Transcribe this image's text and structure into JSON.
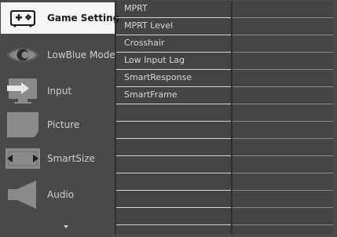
{
  "menu": {
    "items": [
      {
        "label": "Game Setting",
        "icon": "gamepad-icon",
        "active": true
      },
      {
        "label": "LowBlue Mode",
        "icon": "eye-icon",
        "active": false
      },
      {
        "label": "Input",
        "icon": "input-icon",
        "active": false
      },
      {
        "label": "Picture",
        "icon": "picture-icon",
        "active": false
      },
      {
        "label": "SmartSize",
        "icon": "smartsize-icon",
        "active": false
      },
      {
        "label": "Audio",
        "icon": "speaker-icon",
        "active": false
      }
    ],
    "more_icon": "scroll-down-arrow-icon"
  },
  "submenu": {
    "items": [
      {
        "label": "MPRT"
      },
      {
        "label": "MPRT Level"
      },
      {
        "label": "Crosshair"
      },
      {
        "label": "Low Input Lag"
      },
      {
        "label": "SmartResponse"
      },
      {
        "label": "SmartFrame"
      },
      {
        "label": ""
      },
      {
        "label": ""
      },
      {
        "label": ""
      },
      {
        "label": ""
      },
      {
        "label": ""
      },
      {
        "label": ""
      },
      {
        "label": ""
      }
    ]
  },
  "colors": {
    "background": "#444444",
    "menu_background": "#494949",
    "active_item_background": "#f5f5f5",
    "text": "#d8d8d8",
    "active_text": "#1b1b1b"
  }
}
